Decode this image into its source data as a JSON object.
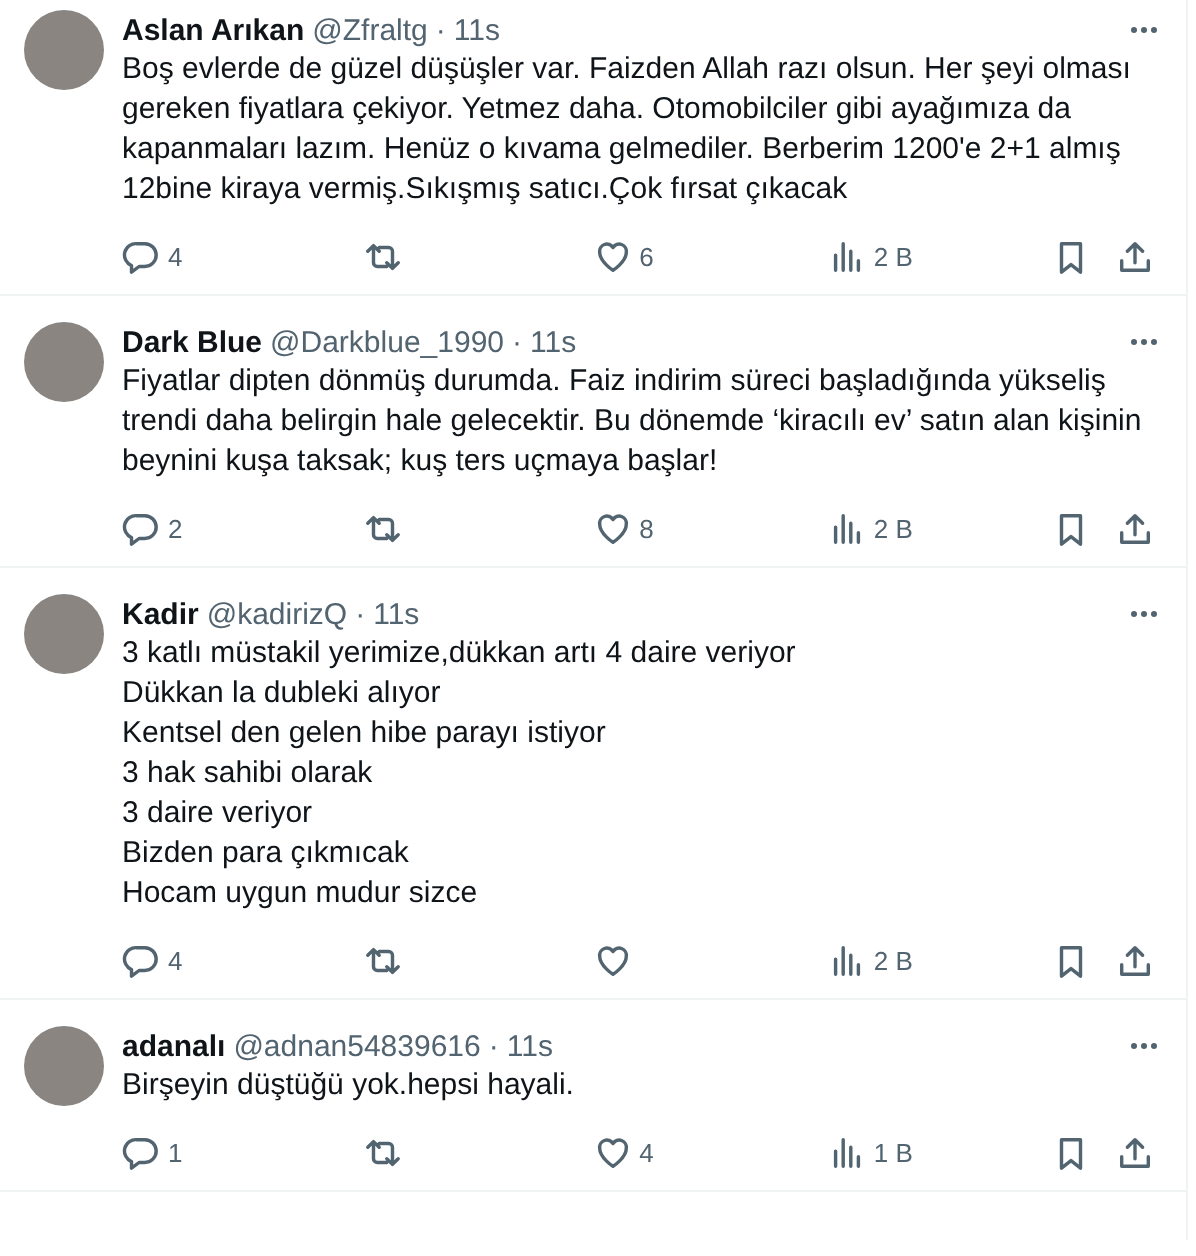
{
  "tweets": [
    {
      "name": "Aslan Arıkan",
      "handle": "@Zfraltg",
      "dot": "·",
      "time": "11s",
      "text": "Boş evlerde de güzel düşüşler var. Faizden Allah razı olsun. Her şeyi olması gereken fiyatlara çekiyor. Yetmez daha. Otomobilciler gibi ayağımıza da kapanmaları lazım. Henüz o kıvama gelmediler. Berberim 1200'e 2+1 almış 12bine kiraya vermiş.Sıkışmış satıcı.Çok fırsat çıkacak",
      "replies": "4",
      "likes": "6",
      "views": "2 B"
    },
    {
      "name": "Dark Blue",
      "handle": "@Darkblue_1990",
      "dot": "·",
      "time": "11s",
      "text": "Fiyatlar dipten dönmüş durumda. Faiz indirim süreci başladığında yükseliş trendi daha belirgin hale gelecektir. Bu dönemde ‘kiracılı ev’ satın alan kişinin beynini kuşa taksak; kuş ters uçmaya başlar!",
      "replies": "2",
      "likes": "8",
      "views": "2 B"
    },
    {
      "name": "Kadir",
      "handle": "@kadirizQ",
      "dot": "·",
      "time": "11s",
      "text": "3 katlı müstakil yerimize,dükkan artı 4 daire veriyor\nDükkan la dubleki alıyor\nKentsel den gelen hibe parayı istiyor\n3 hak sahibi olarak\n3 daire veriyor\nBizden para çıkmıcak\nHocam uygun mudur sizce",
      "replies": "4",
      "views": "2 B"
    },
    {
      "name": "adanalı",
      "handle": "@adnan54839616",
      "dot": "·",
      "time": "11s",
      "text": "Birşeyin düştüğü yok.hepsi hayali.",
      "replies": "1",
      "likes": "4",
      "views": "1 B"
    }
  ]
}
